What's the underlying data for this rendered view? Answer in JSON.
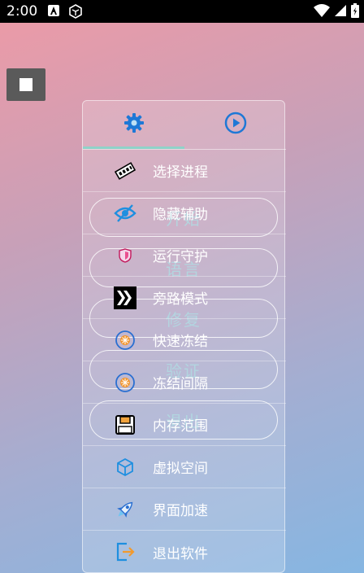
{
  "status_bar": {
    "time": "2:00",
    "icons": [
      "notification-a-icon",
      "notification-cube-icon",
      "wifi-icon",
      "signal-icon",
      "battery-icon"
    ]
  },
  "background_buttons": [
    {
      "label": "开始"
    },
    {
      "label": "语言"
    },
    {
      "label": "修复"
    },
    {
      "label": "验证"
    },
    {
      "label": "退出"
    }
  ],
  "panel": {
    "tabs": [
      {
        "icon": "gear-icon",
        "selected": true
      },
      {
        "icon": "play-circle-icon",
        "selected": false
      }
    ],
    "items": [
      {
        "label": "选择进程",
        "icon": "memory-chip-icon"
      },
      {
        "label": "隐藏辅助",
        "icon": "eye-off-icon"
      },
      {
        "label": "运行守护",
        "icon": "shield-icon"
      },
      {
        "label": "旁路模式",
        "icon": "bypass-arrows-icon"
      },
      {
        "label": "快速冻结",
        "icon": "freeze-circle-icon"
      },
      {
        "label": "冻结间隔",
        "icon": "freeze-circle-icon"
      },
      {
        "label": "内存范围",
        "icon": "floppy-disk-icon"
      },
      {
        "label": "虚拟空间",
        "icon": "cube-icon"
      },
      {
        "label": "界面加速",
        "icon": "rocket-icon"
      },
      {
        "label": "退出软件",
        "icon": "exit-icon"
      }
    ]
  },
  "colors": {
    "tab_underline": "#8fd2c9",
    "accent_blue": "#1e78d6",
    "status_bar": "#000000"
  }
}
